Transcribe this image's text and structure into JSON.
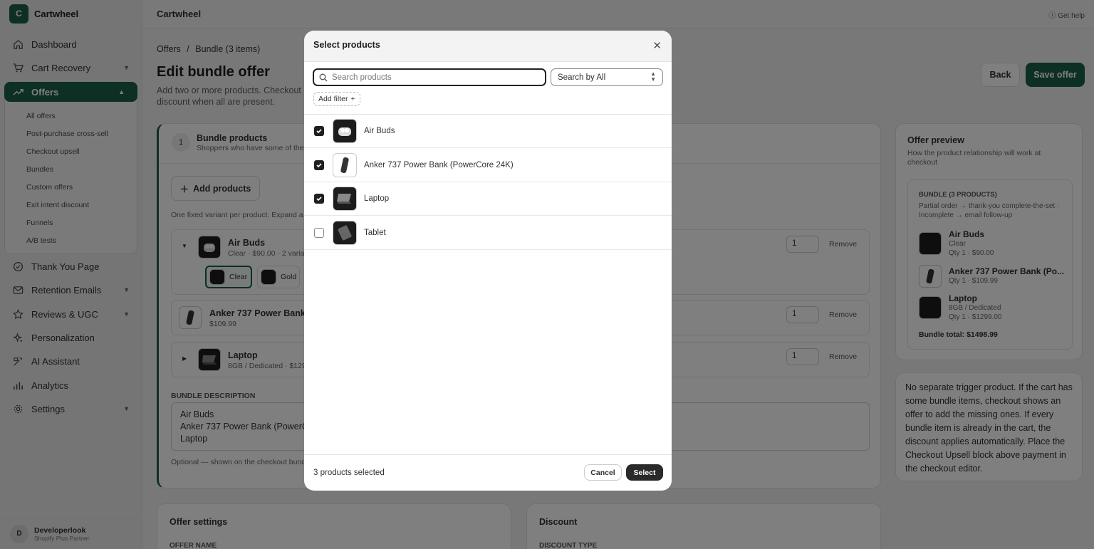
{
  "app": {
    "name": "Cartwheel",
    "logo_letter": "C",
    "help": "Get help"
  },
  "sidebar": {
    "items": [
      {
        "label": "Dashboard",
        "icon": "home-icon"
      },
      {
        "label": "Cart Recovery",
        "icon": "cart-icon"
      },
      {
        "label": "Offers",
        "icon": "trend-icon"
      },
      {
        "label": "Thank You Page",
        "icon": "check-circle-icon"
      },
      {
        "label": "Retention Emails",
        "icon": "mail-icon"
      },
      {
        "label": "Reviews & UGC",
        "icon": "star-icon"
      },
      {
        "label": "Personalization",
        "icon": "sparkle-icon"
      },
      {
        "label": "AI Assistant",
        "icon": "wand-icon"
      },
      {
        "label": "Analytics",
        "icon": "bar-chart-icon"
      },
      {
        "label": "Settings",
        "icon": "gear-icon"
      }
    ],
    "offers_sub": [
      "All offers",
      "Post-purchase cross-sell",
      "Checkout upsell",
      "Bundles",
      "Custom offers",
      "Exit intent discount",
      "Funnels",
      "A/B tests"
    ],
    "user": {
      "initial": "D",
      "name": "Developerlook",
      "role": "Shopify Plus Partner"
    }
  },
  "page": {
    "crumb_root": "Offers",
    "crumb_sep": "/",
    "crumb_current": "Bundle (3 items)",
    "title": "Edit bundle offer",
    "subtitle": "Add two or more products. Checkout discount when all are present.",
    "back": "Back",
    "save": "Save offer"
  },
  "bundle": {
    "step": "1",
    "title": "Bundle products",
    "subtitle": "Shoppers who have some of the",
    "add_btn": "Add products",
    "hint": "One fixed variant per product. Expand a",
    "remove": "Remove",
    "items": [
      {
        "name": "Air Buds",
        "meta": "Clear · $90.00 · 2 varia",
        "qty": "1"
      },
      {
        "name": "Anker 737 Power Bank (",
        "meta": "$109.99",
        "qty": "1"
      },
      {
        "name": "Laptop",
        "meta": "8GB / Dedicated · $129",
        "qty": "1"
      }
    ],
    "variants": [
      "Clear",
      "Gold"
    ],
    "desc_label": "BUNDLE DESCRIPTION",
    "desc_lines": [
      "Air Buds",
      "Anker 737 Power Bank (PowerC",
      "Laptop"
    ],
    "desc_hint": "Optional — shown on the checkout bund"
  },
  "preview": {
    "title": "Offer preview",
    "subtitle": "How the product relationship will work at checkout",
    "box_title": "BUNDLE (3 PRODUCTS)",
    "box_sub": "Partial order → thank-you complete-the-set · Incomplete → email follow-up",
    "items": [
      {
        "name": "Air Buds",
        "l1": "Clear",
        "l2": "Qty 1 · $90.00"
      },
      {
        "name": "Anker 737 Power Bank (Po...",
        "l1": "Qty 1 · $109.99",
        "l2": ""
      },
      {
        "name": "Laptop",
        "l1": "8GB / Dedicated",
        "l2": "Qty 1 · $1299.00"
      }
    ],
    "total": "Bundle total: $1498.99",
    "note": "No separate trigger product. If the cart has some bundle items, checkout shows an offer to add the missing ones. If every bundle item is already in the cart, the discount applies automatically. Place the Checkout Upsell block above payment in the checkout editor."
  },
  "settings": {
    "title": "Offer settings",
    "field": "OFFER NAME"
  },
  "discount": {
    "title": "Discount",
    "field": "DISCOUNT TYPE"
  },
  "modal": {
    "title": "Select products",
    "search_placeholder": "Search products",
    "search_by": "Search by All",
    "add_filter": "Add filter",
    "products": [
      {
        "name": "Air Buds",
        "checked": true
      },
      {
        "name": "Anker 737 Power Bank (PowerCore 24K)",
        "checked": true
      },
      {
        "name": "Laptop",
        "checked": true
      },
      {
        "name": "Tablet",
        "checked": false
      }
    ],
    "selected_count": "3 products selected",
    "cancel": "Cancel",
    "select": "Select"
  }
}
